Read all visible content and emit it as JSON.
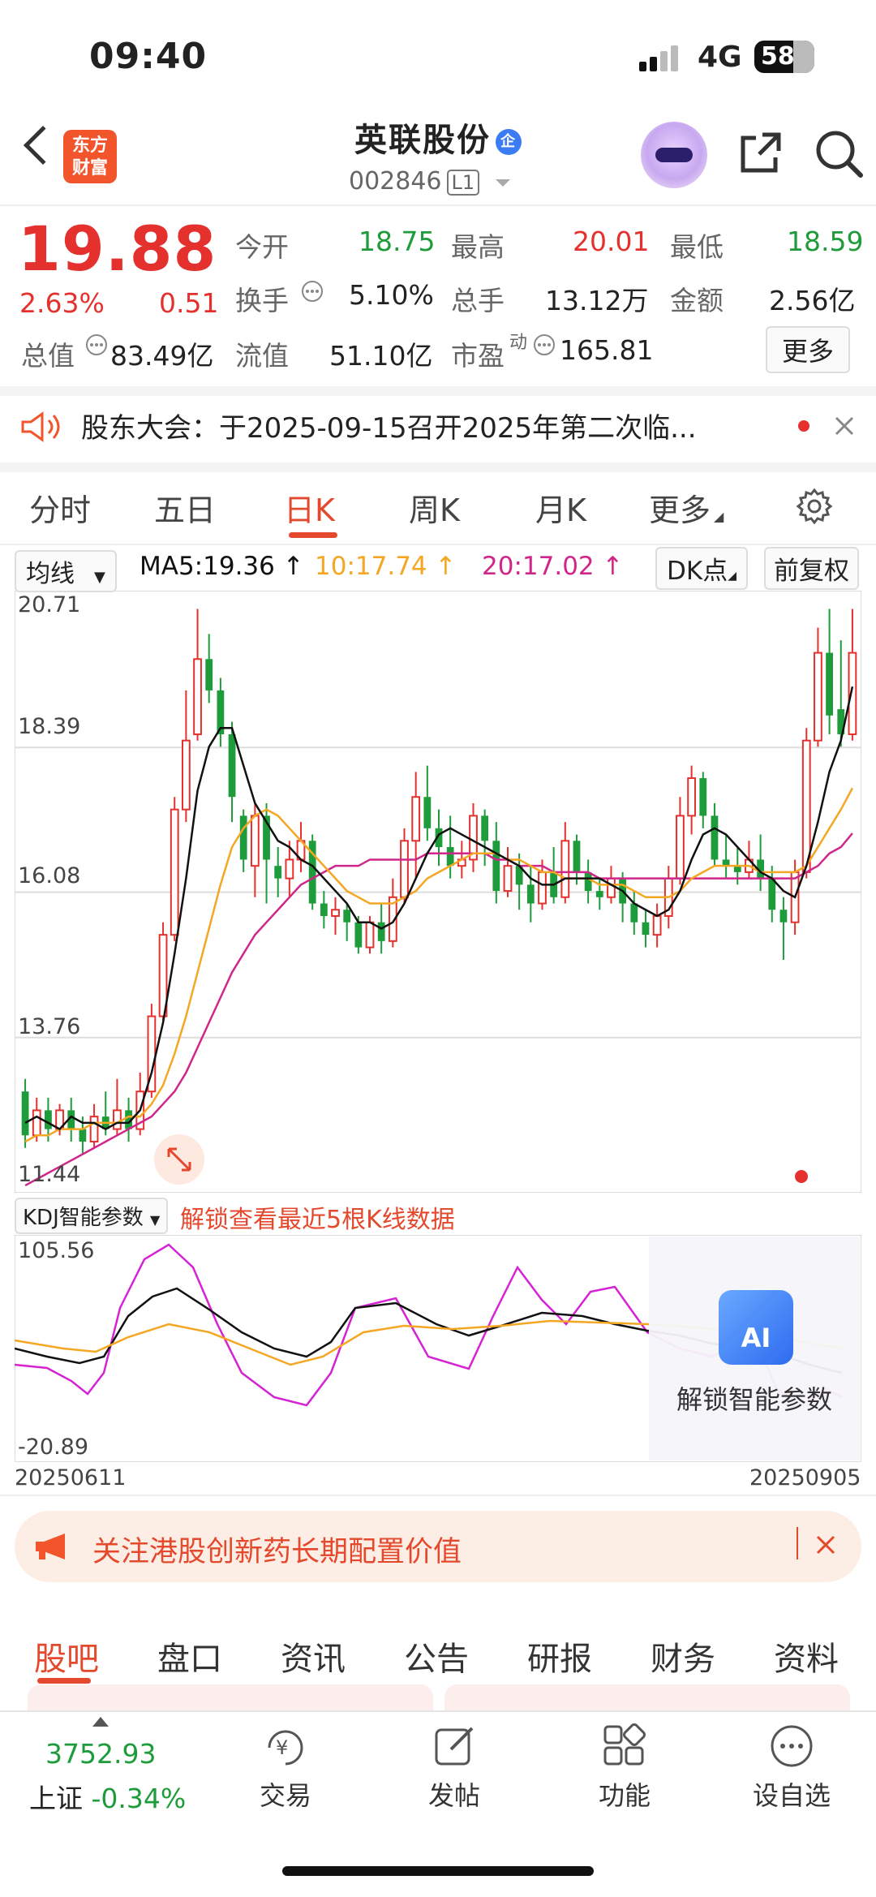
{
  "status": {
    "time": "09:40",
    "network": "4G",
    "battery": "58"
  },
  "header": {
    "logo_text": "东方\n财富",
    "logo_line1": "东方",
    "logo_line2": "财富",
    "stock_name": "英联股份",
    "badge": "企",
    "code": "002846",
    "level": "L1"
  },
  "quote": {
    "price": "19.88",
    "change_pct": "2.63%",
    "change": "0.51",
    "open_label": "今开",
    "open": "18.75",
    "high_label": "最高",
    "high": "20.01",
    "low_label": "最低",
    "low": "18.59",
    "turnover_label": "换手",
    "turnover": "5.10%",
    "volume_label": "总手",
    "volume": "13.12万",
    "amount_label": "金额",
    "amount": "2.56亿",
    "mktcap_label": "总值",
    "mktcap": "83.49亿",
    "float_label": "流值",
    "float": "51.10亿",
    "pe_label": "市盈",
    "pe_sup": "动",
    "pe": "165.81",
    "more": "更多"
  },
  "notice": {
    "text": "股东大会：于2025-09-15召开2025年第二次临..."
  },
  "chart_tabs": {
    "t1": "分时",
    "t2": "五日",
    "t3": "日K",
    "t4": "周K",
    "t5": "月K",
    "t6": "更多"
  },
  "indicators": {
    "ma_select": "均线",
    "ma5": "MA5:19.36",
    "ma10": "10:17.74",
    "ma20": "20:17.02",
    "dk": "DK点",
    "adjust": "前复权"
  },
  "chart_data": {
    "type": "candlestick",
    "y_ticks": [
      "20.71",
      "18.39",
      "16.08",
      "13.76",
      "11.44"
    ],
    "ylim": [
      11.44,
      20.71
    ],
    "x_start": "20250611",
    "x_end": "20250905",
    "series": [
      {
        "name": "MA5",
        "value": 19.36,
        "color": "#111111"
      },
      {
        "name": "MA10",
        "value": 17.74,
        "color": "#f5a623"
      },
      {
        "name": "MA20",
        "value": 17.02,
        "color": "#d0268a"
      }
    ],
    "candles": [
      [
        12.9,
        12.2,
        13.1,
        12.0
      ],
      [
        12.2,
        12.6,
        12.8,
        12.1
      ],
      [
        12.6,
        12.3,
        12.8,
        12.1
      ],
      [
        12.3,
        12.6,
        12.7,
        12.2
      ],
      [
        12.6,
        12.3,
        12.8,
        12.1
      ],
      [
        12.3,
        12.1,
        12.5,
        11.9
      ],
      [
        12.1,
        12.5,
        12.7,
        12.0
      ],
      [
        12.5,
        12.3,
        12.9,
        12.2
      ],
      [
        12.3,
        12.6,
        13.1,
        12.2
      ],
      [
        12.6,
        12.3,
        12.8,
        12.1
      ],
      [
        12.3,
        12.9,
        13.2,
        12.2
      ],
      [
        12.9,
        14.1,
        14.3,
        12.8
      ],
      [
        14.1,
        15.4,
        15.6,
        14.0
      ],
      [
        15.4,
        17.4,
        17.6,
        15.3
      ],
      [
        17.4,
        18.5,
        19.3,
        17.2
      ],
      [
        18.6,
        19.8,
        20.6,
        18.5
      ],
      [
        19.8,
        19.3,
        20.2,
        19.1
      ],
      [
        19.3,
        18.6,
        19.5,
        18.4
      ],
      [
        18.6,
        17.6,
        18.8,
        17.2
      ],
      [
        17.3,
        16.6,
        17.4,
        16.4
      ],
      [
        16.5,
        17.3,
        17.5,
        16.0
      ],
      [
        17.3,
        16.6,
        17.5,
        15.9
      ],
      [
        16.5,
        16.3,
        16.8,
        16.0
      ],
      [
        16.3,
        16.6,
        16.9,
        16.0
      ],
      [
        16.6,
        16.9,
        17.2,
        16.4
      ],
      [
        16.9,
        15.9,
        17.0,
        15.8
      ],
      [
        15.9,
        15.7,
        16.1,
        15.5
      ],
      [
        15.7,
        15.8,
        16.0,
        15.4
      ],
      [
        15.8,
        15.6,
        15.9,
        15.3
      ],
      [
        15.6,
        15.2,
        15.7,
        15.1
      ],
      [
        15.2,
        15.6,
        15.7,
        15.1
      ],
      [
        15.6,
        15.3,
        15.9,
        15.1
      ],
      [
        15.3,
        16.0,
        16.3,
        15.2
      ],
      [
        16.0,
        16.9,
        17.1,
        15.9
      ],
      [
        16.9,
        17.6,
        18.0,
        16.3
      ],
      [
        17.6,
        17.1,
        18.1,
        16.9
      ],
      [
        17.1,
        16.8,
        17.4,
        16.5
      ],
      [
        16.8,
        16.5,
        17.3,
        16.3
      ],
      [
        16.5,
        16.6,
        16.9,
        16.3
      ],
      [
        16.6,
        17.3,
        17.5,
        16.4
      ],
      [
        17.3,
        16.9,
        17.4,
        16.5
      ],
      [
        16.9,
        16.1,
        17.2,
        15.9
      ],
      [
        16.1,
        16.5,
        16.8,
        16.0
      ],
      [
        16.5,
        16.2,
        16.7,
        15.8
      ],
      [
        16.2,
        15.9,
        16.5,
        15.6
      ],
      [
        15.9,
        16.4,
        16.6,
        15.8
      ],
      [
        16.4,
        16.0,
        16.8,
        15.9
      ],
      [
        16.0,
        16.9,
        17.2,
        15.9
      ],
      [
        16.9,
        16.4,
        17.0,
        16.2
      ],
      [
        16.4,
        16.1,
        16.6,
        15.9
      ],
      [
        16.1,
        16.0,
        16.3,
        15.8
      ],
      [
        16.0,
        16.3,
        16.5,
        15.9
      ],
      [
        16.3,
        15.9,
        16.4,
        15.6
      ],
      [
        15.9,
        15.6,
        16.1,
        15.4
      ],
      [
        15.6,
        15.4,
        15.8,
        15.2
      ],
      [
        15.4,
        15.7,
        15.9,
        15.2
      ],
      [
        15.7,
        16.3,
        16.5,
        15.5
      ],
      [
        16.3,
        17.3,
        17.6,
        16.2
      ],
      [
        17.3,
        17.9,
        18.1,
        17.0
      ],
      [
        17.9,
        17.3,
        18.0,
        17.1
      ],
      [
        17.3,
        16.6,
        17.5,
        16.5
      ],
      [
        16.6,
        16.5,
        17.0,
        16.3
      ],
      [
        16.5,
        16.4,
        16.8,
        16.2
      ],
      [
        16.4,
        16.6,
        16.9,
        16.3
      ],
      [
        16.6,
        16.3,
        17.0,
        16.1
      ],
      [
        16.3,
        15.8,
        16.5,
        15.6
      ],
      [
        15.8,
        15.6,
        16.0,
        15.0
      ],
      [
        15.6,
        16.4,
        16.6,
        15.4
      ],
      [
        16.4,
        18.5,
        18.7,
        16.3
      ],
      [
        18.5,
        19.9,
        20.3,
        18.4
      ],
      [
        19.9,
        18.9,
        20.6,
        18.6
      ],
      [
        19.0,
        18.6,
        20.1,
        18.4
      ],
      [
        18.6,
        19.9,
        20.6,
        18.5
      ]
    ],
    "ma5_path": [
      12.4,
      12.5,
      12.4,
      12.3,
      12.5,
      12.4,
      12.4,
      12.3,
      12.4,
      12.4,
      12.6,
      13.2,
      14.0,
      15.1,
      16.3,
      17.7,
      18.4,
      18.7,
      18.7,
      18.1,
      17.5,
      17.2,
      16.9,
      16.8,
      16.6,
      16.5,
      16.3,
      16.1,
      15.9,
      15.6,
      15.6,
      15.5,
      15.6,
      15.9,
      16.3,
      16.7,
      17.0,
      17.1,
      17.0,
      16.9,
      16.8,
      16.7,
      16.6,
      16.5,
      16.3,
      16.2,
      16.2,
      16.3,
      16.3,
      16.3,
      16.3,
      16.2,
      16.1,
      15.9,
      15.8,
      15.7,
      15.8,
      16.1,
      16.6,
      17.0,
      17.1,
      17.0,
      16.8,
      16.6,
      16.4,
      16.3,
      16.1,
      16.0,
      16.5,
      17.2,
      18.0,
      18.5,
      19.36
    ],
    "ma10_path": [
      12.1,
      12.2,
      12.2,
      12.3,
      12.3,
      12.3,
      12.4,
      12.4,
      12.4,
      12.5,
      12.5,
      12.7,
      13.0,
      13.5,
      14.1,
      14.8,
      15.5,
      16.2,
      16.8,
      17.1,
      17.3,
      17.4,
      17.3,
      17.1,
      16.9,
      16.7,
      16.5,
      16.3,
      16.1,
      16.0,
      15.9,
      15.9,
      15.9,
      16.0,
      16.1,
      16.3,
      16.4,
      16.5,
      16.6,
      16.7,
      16.7,
      16.7,
      16.6,
      16.6,
      16.5,
      16.4,
      16.4,
      16.3,
      16.3,
      16.3,
      16.2,
      16.2,
      16.2,
      16.1,
      16.0,
      16.0,
      16.0,
      16.1,
      16.3,
      16.4,
      16.5,
      16.5,
      16.5,
      16.5,
      16.4,
      16.4,
      16.4,
      16.4,
      16.5,
      16.8,
      17.1,
      17.4,
      17.74
    ],
    "ma20_path": [
      11.4,
      11.5,
      11.6,
      11.7,
      11.8,
      11.9,
      12.0,
      12.1,
      12.2,
      12.3,
      12.4,
      12.5,
      12.7,
      12.9,
      13.2,
      13.6,
      14.0,
      14.4,
      14.8,
      15.1,
      15.4,
      15.6,
      15.8,
      16.0,
      16.2,
      16.3,
      16.4,
      16.5,
      16.5,
      16.5,
      16.6,
      16.6,
      16.6,
      16.6,
      16.6,
      16.7,
      16.7,
      16.7,
      16.7,
      16.7,
      16.7,
      16.6,
      16.6,
      16.5,
      16.5,
      16.5,
      16.4,
      16.4,
      16.4,
      16.4,
      16.3,
      16.3,
      16.3,
      16.3,
      16.3,
      16.3,
      16.3,
      16.3,
      16.3,
      16.3,
      16.3,
      16.3,
      16.3,
      16.3,
      16.3,
      16.3,
      16.3,
      16.3,
      16.4,
      16.5,
      16.7,
      16.8,
      17.02
    ]
  },
  "kdj": {
    "label": "KDJ智能参数",
    "unlock_text": "解锁查看最近5根K线数据",
    "y_top": "105.56",
    "y_bottom": "-20.89",
    "x_start": "20250611",
    "x_end": "20250905",
    "ai_text": "AI",
    "ai_label": "解锁智能参数"
  },
  "banner": {
    "text": "关注港股创新药长期配置价值"
  },
  "bottom_tabs": {
    "b1": "股吧",
    "b2": "盘口",
    "b3": "资讯",
    "b4": "公告",
    "b5": "研报",
    "b6": "财务",
    "b7": "资料"
  },
  "bottom_bar": {
    "index_value": "3752.93",
    "index_name": "上证",
    "index_change": "-0.34%",
    "trade": "交易",
    "post": "发帖",
    "func": "功能",
    "watch": "设自选"
  }
}
